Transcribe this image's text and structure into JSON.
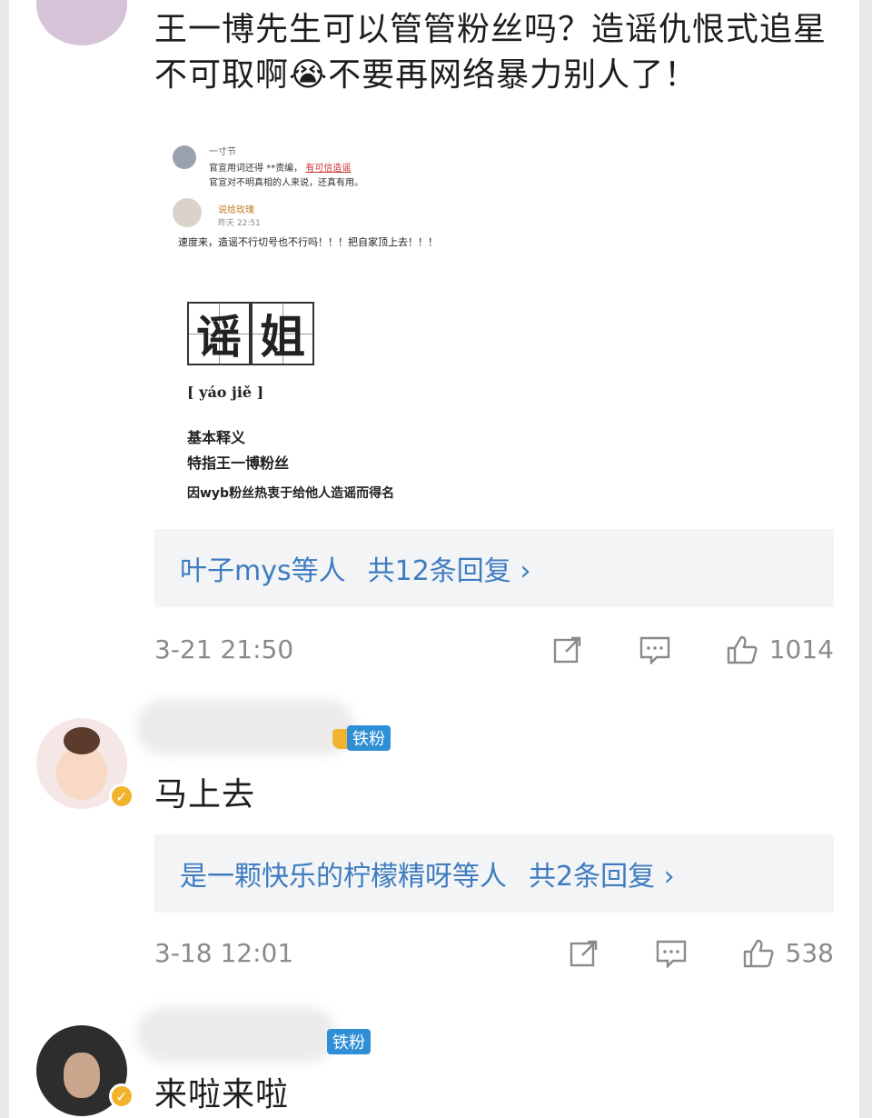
{
  "comment1": {
    "text": "王一博先生可以管管粉丝吗？造谣仇恨式追星不可取啊😭不要再网络暴力别人了！",
    "embedded_image": {
      "top_user": "一寸节",
      "top_text_line1": "官宣用词还得",
      "top_text_mid": "**责编，",
      "top_text_highlight": "有可信造谣",
      "top_text_line2": "官宣对不明真相的人来说，还真有用。",
      "second_user": "说给玫瑰",
      "second_time": "昨天 22:51",
      "second_text": "速度来，造谣不行切号也不行吗！！！把自家顶上去！！！",
      "char1": "谣",
      "char2": "姐",
      "pinyin": "[ yáo jiě ]",
      "def_title": "基本释义",
      "def_line1": "特指王一博粉丝",
      "def_line2": "因wyb粉丝热衷于给他人造谣而得名"
    },
    "reply_names": "叶子mys等人",
    "reply_count": "共12条回复 ›",
    "time": "3-21 21:50",
    "likes": "1014"
  },
  "comment2": {
    "badge": "铁粉",
    "text": "马上去",
    "reply_names": "是一颗快乐的柠檬精呀等人",
    "reply_count": "共2条回复 ›",
    "time": "3-18 12:01",
    "likes": "538"
  },
  "comment3": {
    "badge": "铁粉",
    "text": "来啦来啦"
  },
  "colors": {
    "link_blue": "#3f7cc0",
    "badge_blue": "#2f8fd6",
    "verified_gold": "#f2b32c"
  }
}
